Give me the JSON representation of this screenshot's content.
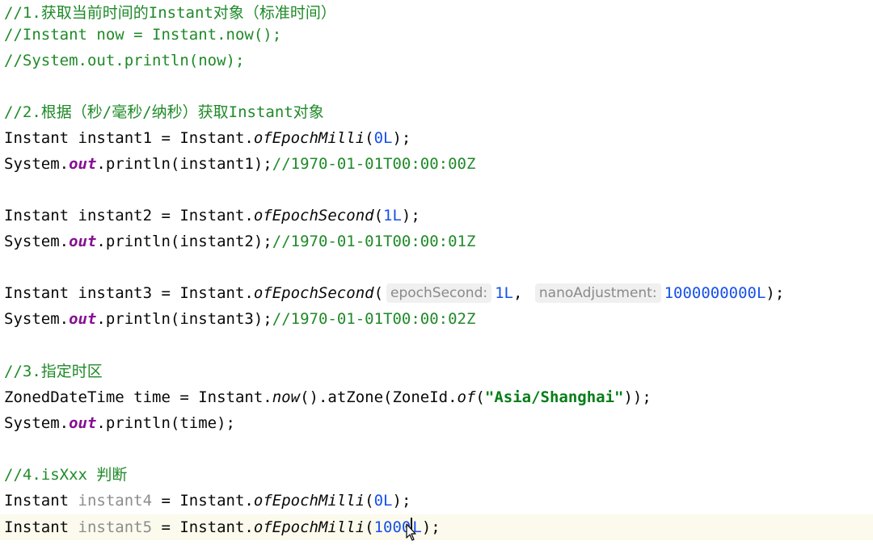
{
  "lines": {
    "l1": {
      "comment": "//1.获取当前时间的Instant对象（标准时间）"
    },
    "l2": {
      "comment": "//Instant now = Instant.now();"
    },
    "l3": {
      "comment": "//System.out.println(now);"
    },
    "l5": {
      "comment": "//2.根据（秒/毫秒/纳秒）获取Instant对象"
    },
    "l6": {
      "pre": "Instant instant1 = Instant.",
      "method": "ofEpochMilli",
      "open": "(",
      "num": "0L",
      "close": ");"
    },
    "l7": {
      "pre": "System.",
      "field": "out",
      "mid": ".println(instant1);",
      "comment": "//1970-01-01T00:00:00Z"
    },
    "l9": {
      "pre": "Instant instant2 = Instant.",
      "method": "ofEpochSecond",
      "open": "(",
      "num": "1L",
      "close": ");"
    },
    "l10": {
      "pre": "System.",
      "field": "out",
      "mid": ".println(instant2);",
      "comment": "//1970-01-01T00:00:01Z"
    },
    "l12": {
      "pre": "Instant instant3 = Instant.",
      "method": "ofEpochSecond",
      "open": "(",
      "hint1": "epochSecond:",
      "num1": "1L",
      "sep": ", ",
      "hint2": "nanoAdjustment:",
      "num2": "1000000000L",
      "close": ");"
    },
    "l13": {
      "pre": "System.",
      "field": "out",
      "mid": ".println(instant3);",
      "comment": "//1970-01-01T00:00:02Z"
    },
    "l15": {
      "comment": "//3.指定时区"
    },
    "l16": {
      "pre": "ZonedDateTime time = Instant.",
      "method1": "now",
      "mid1": "().atZone(ZoneId.",
      "method2": "of",
      "open": "(",
      "str": "\"Asia/Shanghai\"",
      "close": "));"
    },
    "l17": {
      "pre": "System.",
      "field": "out",
      "mid": ".println(time);"
    },
    "l19": {
      "comment": "//4.isXxx 判断"
    },
    "l20": {
      "pre": "Instant ",
      "var": "instant4",
      "eq": " = Instant.",
      "method": "ofEpochMilli",
      "open": "(",
      "num": "0L",
      "close": ");"
    },
    "l21": {
      "pre": "Instant ",
      "var": "instant5",
      "eq": " = Instant.",
      "method": "ofEpochMilli",
      "open": "(",
      "num": "1000",
      "after_caret": "L",
      "close": ");"
    }
  },
  "icons": {
    "mouse_cursor": "mouse-pointer-icon"
  },
  "colors": {
    "comment": "#1f8a28",
    "number": "#1750eb",
    "string": "#067d17",
    "static_field": "#871094",
    "unused_variable": "#8c8c8c",
    "current_line_background": "#fcfaed"
  }
}
